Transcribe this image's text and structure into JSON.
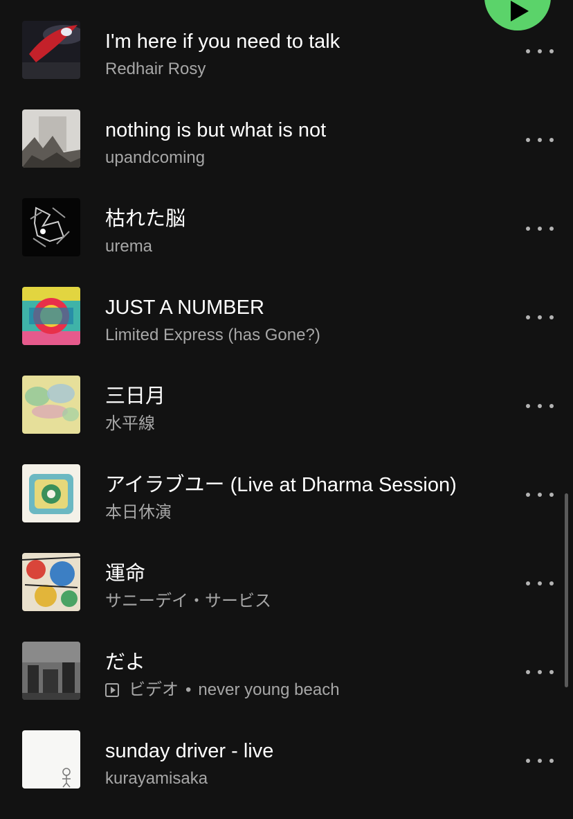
{
  "player": {
    "play_icon": "play-icon",
    "accent_color": "#5bd36a"
  },
  "tracks": [
    {
      "title": "I'm here if you need to talk",
      "artist": "Redhair Rosy",
      "more_icon": "more-horizontal-icon"
    },
    {
      "title": "nothing is but what is not",
      "artist": "upandcoming",
      "more_icon": "more-horizontal-icon"
    },
    {
      "title": "枯れた脳",
      "artist": "urema",
      "more_icon": "more-horizontal-icon"
    },
    {
      "title": "JUST A NUMBER",
      "artist": "Limited Express (has Gone?)",
      "more_icon": "more-horizontal-icon"
    },
    {
      "title": "三日月",
      "artist": "水平線",
      "more_icon": "more-horizontal-icon"
    },
    {
      "title": "アイラブユー (Live at Dharma Session)",
      "artist": "本日休演",
      "more_icon": "more-horizontal-icon"
    },
    {
      "title": "運命",
      "artist": "サニーデイ・サービス",
      "more_icon": "more-horizontal-icon"
    },
    {
      "title": "だよ",
      "type_label": "ビデオ",
      "separator": "•",
      "artist": "never young beach",
      "more_icon": "more-horizontal-icon"
    },
    {
      "title": "sunday driver - live",
      "artist": "kurayamisaka",
      "more_icon": "more-horizontal-icon"
    }
  ]
}
